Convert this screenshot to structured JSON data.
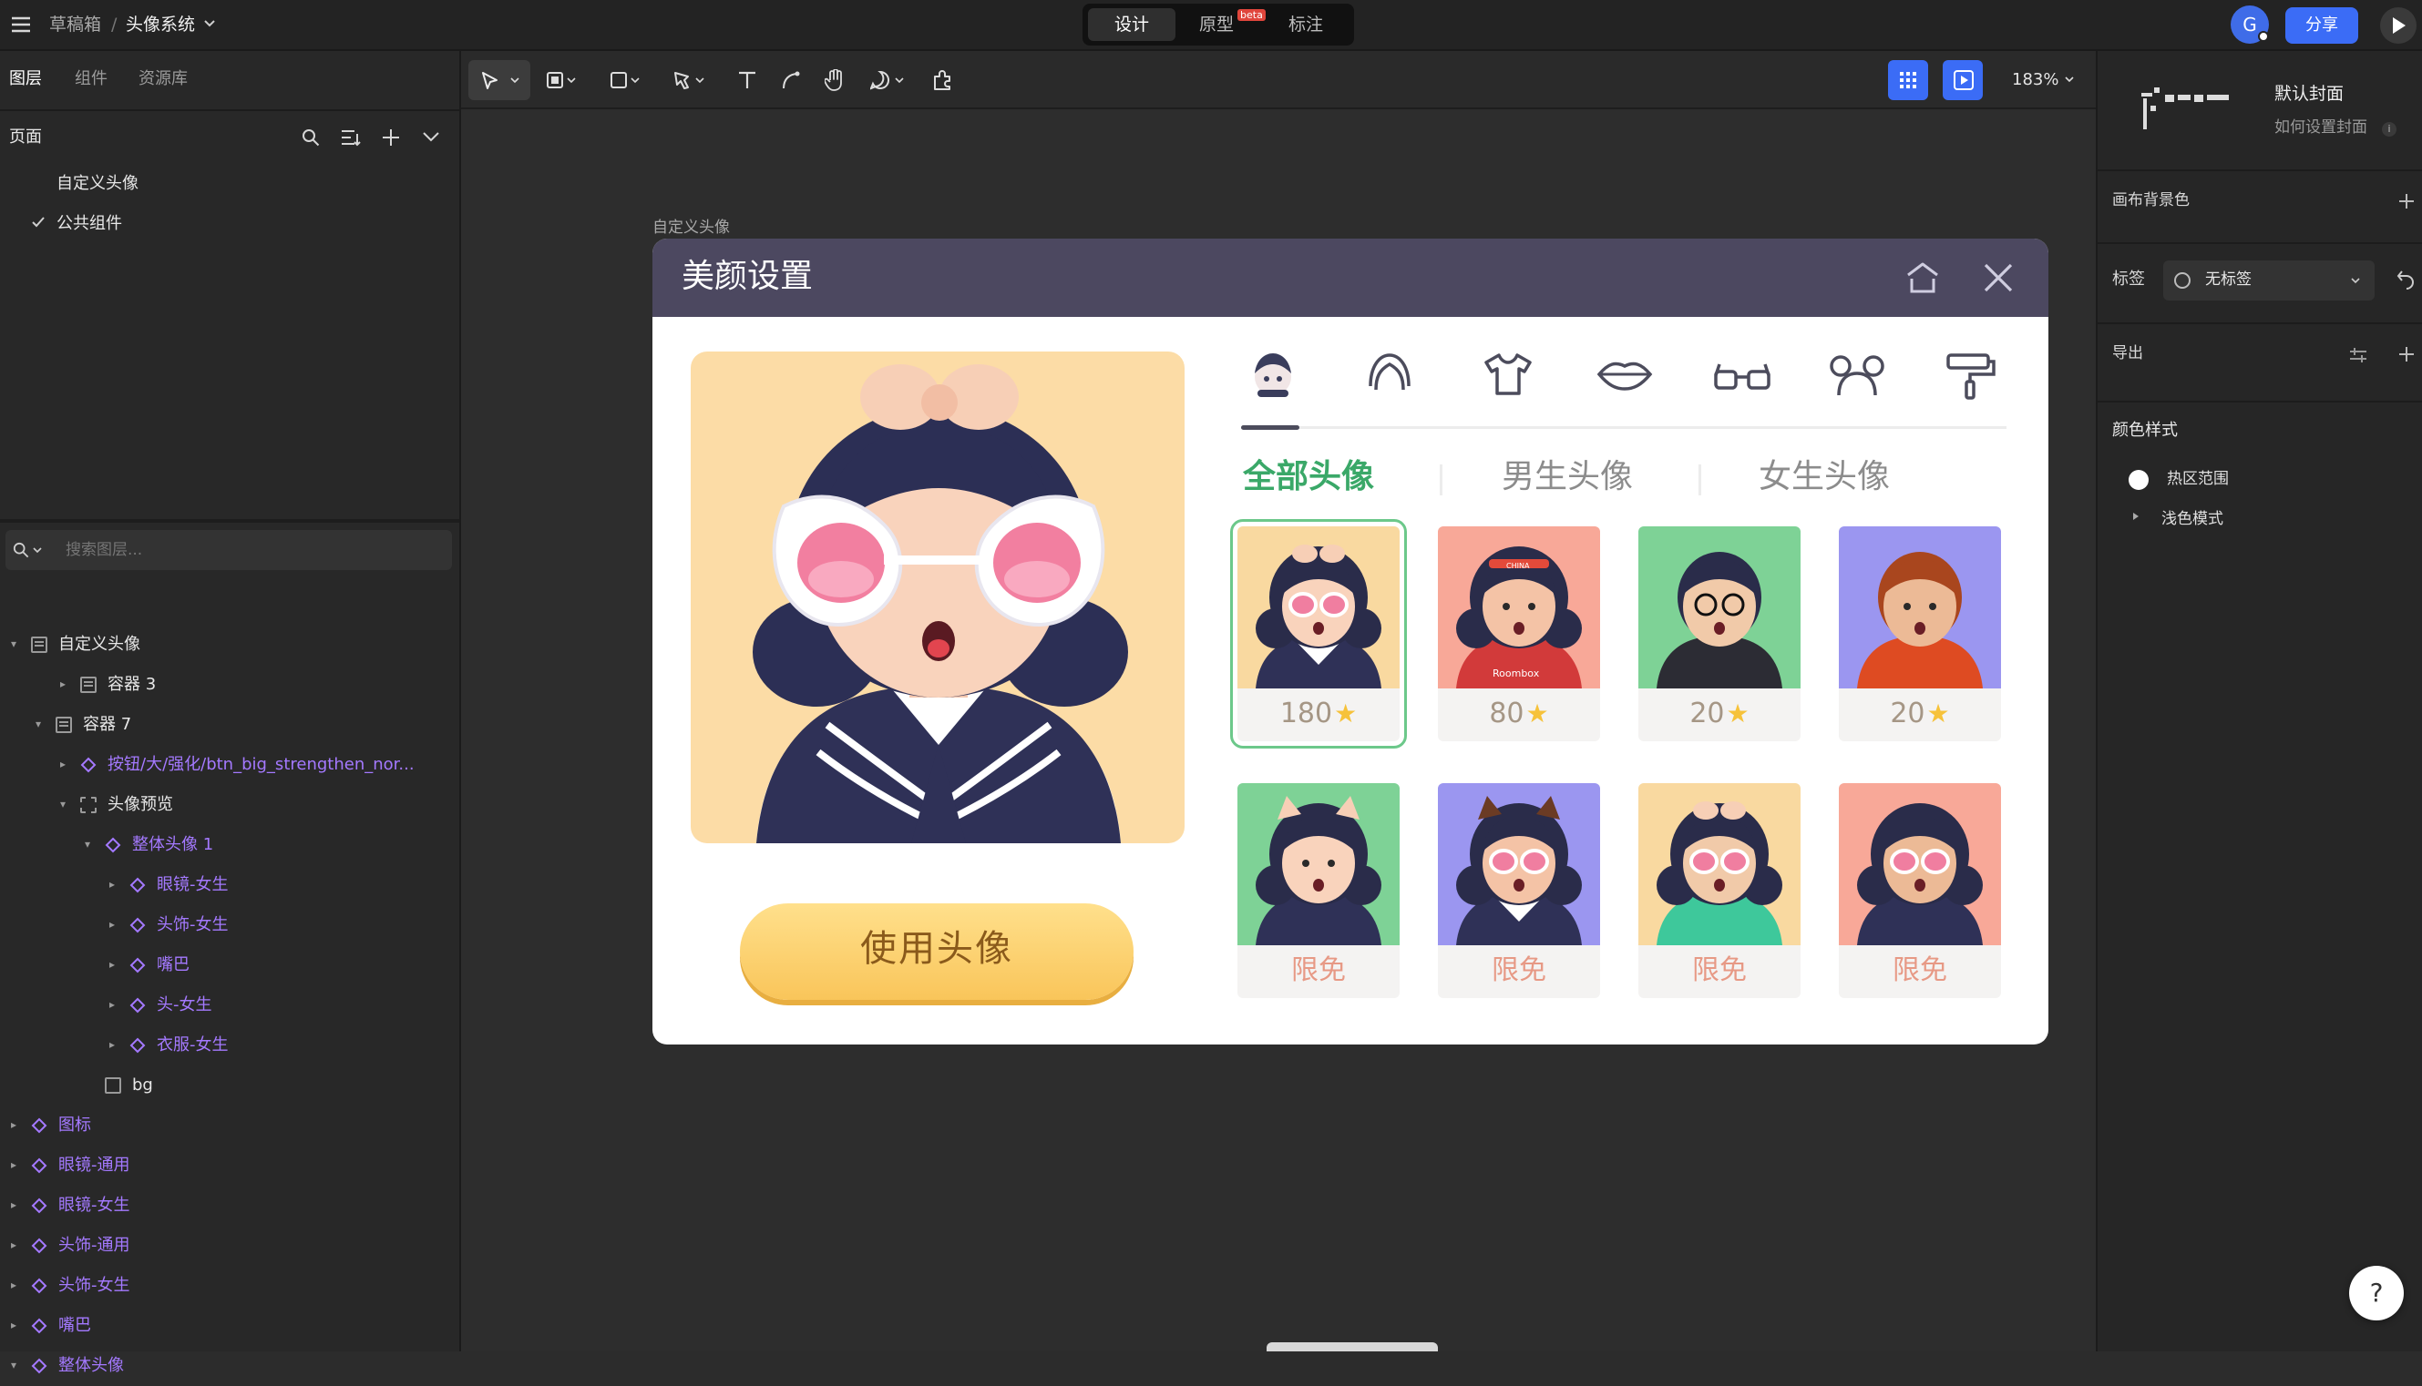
{
  "topbar": {
    "breadcrumb_root": "草稿箱",
    "breadcrumb_sep": "/",
    "file_name": "头像系统",
    "modes": [
      "设计",
      "原型",
      "标注"
    ],
    "beta_badge": "beta",
    "avatar_letter": "G",
    "share_label": "分享"
  },
  "left": {
    "tabs": [
      "图层",
      "组件",
      "资源库"
    ],
    "pages_title": "页面",
    "pages": [
      "自定义头像",
      "公共组件"
    ],
    "search_placeholder": "搜索图层...",
    "layers": [
      {
        "label": "自定义头像",
        "depth": 0,
        "kind": "frame",
        "caret": "▾",
        "color": "white"
      },
      {
        "label": "容器 3",
        "depth": 2,
        "kind": "frame",
        "caret": "▸",
        "color": "white"
      },
      {
        "label": "容器 7",
        "depth": 1,
        "kind": "frame",
        "caret": "▾",
        "color": "white"
      },
      {
        "label": "按钮/大/强化/btn_big_strengthen_nor...",
        "depth": 2,
        "kind": "comp",
        "caret": "▸",
        "color": "purple"
      },
      {
        "label": "头像预览",
        "depth": 2,
        "kind": "dashed",
        "caret": "▾",
        "color": "white"
      },
      {
        "label": "整体头像 1",
        "depth": 3,
        "kind": "comp",
        "caret": "▾",
        "color": "purple"
      },
      {
        "label": "眼镜-女生",
        "depth": 4,
        "kind": "comp",
        "caret": "▸",
        "color": "purple"
      },
      {
        "label": "头饰-女生",
        "depth": 4,
        "kind": "comp",
        "caret": "▸",
        "color": "purple"
      },
      {
        "label": "嘴巴",
        "depth": 4,
        "kind": "comp",
        "caret": "▸",
        "color": "purple"
      },
      {
        "label": "头-女生",
        "depth": 4,
        "kind": "comp",
        "caret": "▸",
        "color": "purple"
      },
      {
        "label": "衣服-女生",
        "depth": 4,
        "kind": "comp",
        "caret": "▸",
        "color": "purple"
      },
      {
        "label": "bg",
        "depth": 3,
        "kind": "rect",
        "caret": "",
        "color": "white"
      },
      {
        "label": "图标",
        "depth": 0,
        "kind": "comp",
        "caret": "▸",
        "color": "purple"
      },
      {
        "label": "眼镜-通用",
        "depth": 0,
        "kind": "comp",
        "caret": "▸",
        "color": "purple"
      },
      {
        "label": "眼镜-女生",
        "depth": 0,
        "kind": "comp",
        "caret": "▸",
        "color": "purple"
      },
      {
        "label": "头饰-通用",
        "depth": 0,
        "kind": "comp",
        "caret": "▸",
        "color": "purple"
      },
      {
        "label": "头饰-女生",
        "depth": 0,
        "kind": "comp",
        "caret": "▸",
        "color": "purple"
      },
      {
        "label": "嘴巴",
        "depth": 0,
        "kind": "comp",
        "caret": "▸",
        "color": "purple"
      },
      {
        "label": "整体头像",
        "depth": 0,
        "kind": "comp",
        "caret": "▾",
        "color": "purple"
      }
    ]
  },
  "toolbar": {
    "zoom": "183%"
  },
  "canvas": {
    "frame_label": "自定义头像",
    "dialog": {
      "title": "美颜设置",
      "category_icons": [
        "face-icon",
        "hair-icon",
        "shirt-icon",
        "lips-icon",
        "glasses-icon",
        "headband-icon",
        "paint-roller-icon"
      ],
      "filter_tabs": [
        "全部头像",
        "男生头像",
        "女生头像"
      ],
      "use_button": "使用头像",
      "avatars": [
        {
          "caption": "180",
          "star": true,
          "bg": "#f9d9a0",
          "selected": true
        },
        {
          "caption": "80",
          "star": true,
          "bg": "#f8a898",
          "selected": false
        },
        {
          "caption": "20",
          "star": true,
          "bg": "#7ed296",
          "selected": false
        },
        {
          "caption": "20",
          "star": true,
          "bg": "#9b96f0",
          "selected": false
        },
        {
          "caption": "限免",
          "star": false,
          "bg": "#7ed296",
          "selected": false
        },
        {
          "caption": "限免",
          "star": false,
          "bg": "#9b96f0",
          "selected": false
        },
        {
          "caption": "限免",
          "star": false,
          "bg": "#f9d9a0",
          "selected": false
        },
        {
          "caption": "限免",
          "star": false,
          "bg": "#f8a898",
          "selected": false
        }
      ],
      "sticker_text": "CHINA",
      "shirt_text": "Roombox"
    }
  },
  "right": {
    "cover_title": "默认封面",
    "cover_link": "如何设置封面",
    "canvas_bg": "画布背景色",
    "tag_label": "标签",
    "tag_value": "无标签",
    "export_label": "导出",
    "color_styles": "颜色样式",
    "styles": [
      "热区范围",
      "浅色模式"
    ]
  },
  "help_label": "?",
  "colors": {
    "accent": "#3b6cf6",
    "purple": "#a479ff",
    "green_tab": "#3aa868",
    "dialog_header": "#4c4860"
  }
}
